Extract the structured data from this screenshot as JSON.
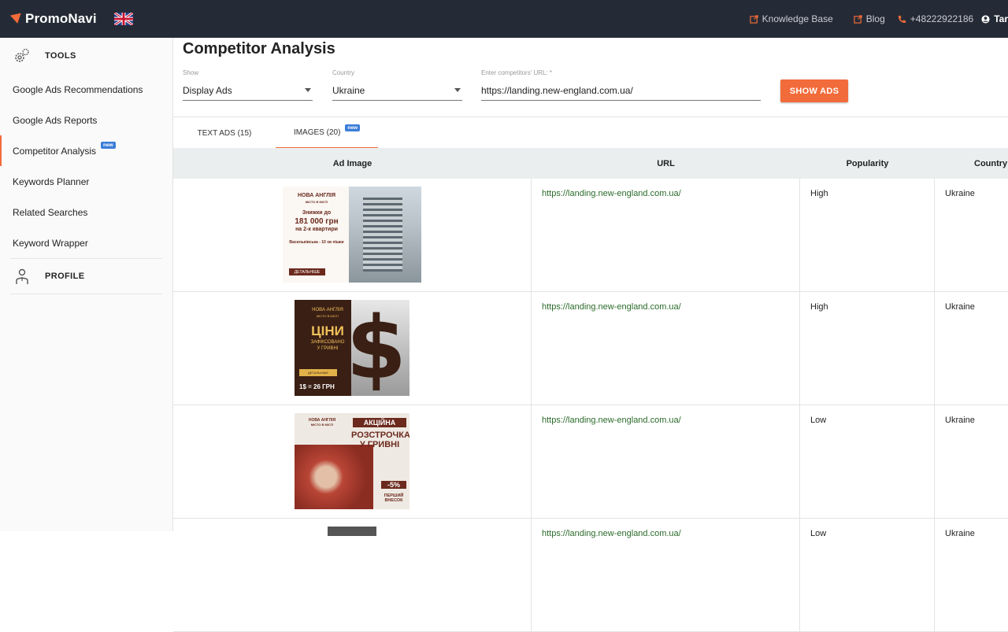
{
  "header": {
    "brand": "PromoNavi",
    "knowledge_base": "Knowledge Base",
    "blog": "Blog",
    "phone": "+48222922186",
    "user": "Tar"
  },
  "sidebar": {
    "tools_label": "TOOLS",
    "items": [
      {
        "label": "Google Ads Recommendations"
      },
      {
        "label": "Google Ads Reports"
      },
      {
        "label": "Competitor Analysis",
        "badge": "new"
      },
      {
        "label": "Keywords Planner"
      },
      {
        "label": "Related Searches"
      },
      {
        "label": "Keyword Wrapper"
      }
    ],
    "profile_label": "PROFILE"
  },
  "page": {
    "title": "Competitor Analysis",
    "show": {
      "label": "Show",
      "value": "Display Ads"
    },
    "country": {
      "label": "Country",
      "value": "Ukraine"
    },
    "url": {
      "label": "Enter competitors' URL: *",
      "value": "https://landing.new-england.com.ua/"
    },
    "show_ads_button": "SHOW ADS"
  },
  "tabs": [
    {
      "label": "TEXT ADS (15)"
    },
    {
      "label": "IMAGES (20)",
      "badge": "new"
    }
  ],
  "table": {
    "columns": [
      "Ad Image",
      "URL",
      "Popularity",
      "Country"
    ],
    "rows": [
      {
        "url": "https://landing.new-england.com.ua/",
        "popularity": "High",
        "country": "Ukraine"
      },
      {
        "url": "https://landing.new-england.com.ua/",
        "popularity": "High",
        "country": "Ukraine"
      },
      {
        "url": "https://landing.new-england.com.ua/",
        "popularity": "Low",
        "country": "Ukraine"
      },
      {
        "url": "https://landing.new-england.com.ua/",
        "popularity": "Low",
        "country": "Ukraine"
      }
    ]
  },
  "ads": {
    "ad1": {
      "brand": "НОВА АНГЛІЯ",
      "sub": "МІСТО В МІСТІ",
      "line1": "Знижки до",
      "line2": "181 000 грн",
      "line3": "на 2-к квартири",
      "line4": "Васильківська - 10 хв пішки",
      "button": "ДЕТАЛЬНІШЕ"
    },
    "ad2": {
      "brand": "НОВА АНГЛІЯ",
      "sub": "МІСТО В МІСТІ",
      "big": "ЦІНИ",
      "line1": "ЗАФІКСОВАНО",
      "line2": "У ГРИВНІ",
      "button": "ДЕТАЛЬНІШЕ",
      "rate": "1$ = 26 ГРН"
    },
    "ad3": {
      "brand": "НОВА АНГЛІЯ",
      "sub": "МІСТО В МІСТІ",
      "h1": "АКЦІЙНА",
      "h2": "РОЗСТРОЧКА У ГРИВНІ",
      "pct": "-5%",
      "pv": "ПЕРШИЙ ВНЕСОК"
    }
  },
  "colors": {
    "accent": "#f26b3a",
    "topbar": "#252b36",
    "link": "#2b6b2b",
    "badge": "#3b7dd8"
  }
}
